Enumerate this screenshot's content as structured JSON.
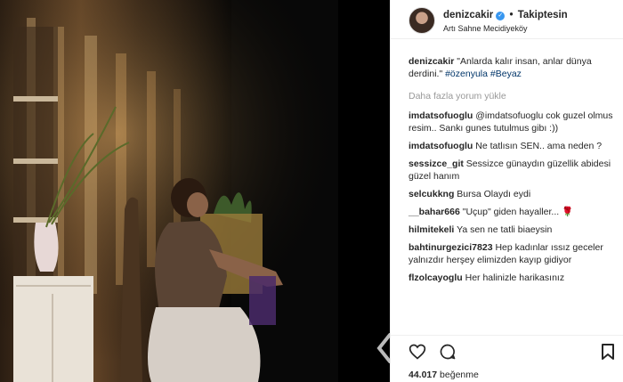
{
  "post": {
    "username": "denizcakir",
    "separator": "•",
    "follow_status": "Takiptesin",
    "location": "Artı Sahne Mecidiyeköy",
    "caption_user": "denizcakir",
    "caption_text": "\"Anlarda kalır insan, anlar dünya derdini.\"",
    "caption_tag1": "#özenyula",
    "caption_tag2": "#Beyaz",
    "load_more": "Daha fazla yorum yükle",
    "likes_count": "44.017",
    "likes_label": "beğenme"
  },
  "comments": [
    {
      "user": "imdatsofuoglu",
      "text": "@imdatsofuoglu cok guzel olmus resim.. Sankı gunes tutulmus gibı :))"
    },
    {
      "user": "imdatsofuoglu",
      "text": "Ne tatlısın SEN.. ama neden ?"
    },
    {
      "user": "sessizce_git",
      "text": "Sessizce günaydın güzellik abidesi güzel hanım"
    },
    {
      "user": "selcukkng",
      "text": "Bursa Olaydı eydi"
    },
    {
      "user": "__bahar666",
      "text": "\"Uçup\" giden hayaller..."
    },
    {
      "user": "hilmitekeli",
      "text": "Ya sen ne tatli biaeysin"
    },
    {
      "user": "bahtinurgezici7823",
      "text": "Hep kadınlar ıssız geceler yalnızdır herşey elimizden kayıp gidiyor"
    },
    {
      "user": "flzolcayoglu",
      "text": "Her halinizle harikasınız"
    }
  ],
  "icons": {
    "like": "heart-icon",
    "comment": "comment-icon",
    "save": "bookmark-icon",
    "verified": "verified-badge-icon",
    "nav": "chevron-left-icon"
  },
  "colors": {
    "text": "#262626",
    "muted": "#999999",
    "link": "#003569",
    "verified": "#3897f0",
    "border": "#efefef"
  }
}
